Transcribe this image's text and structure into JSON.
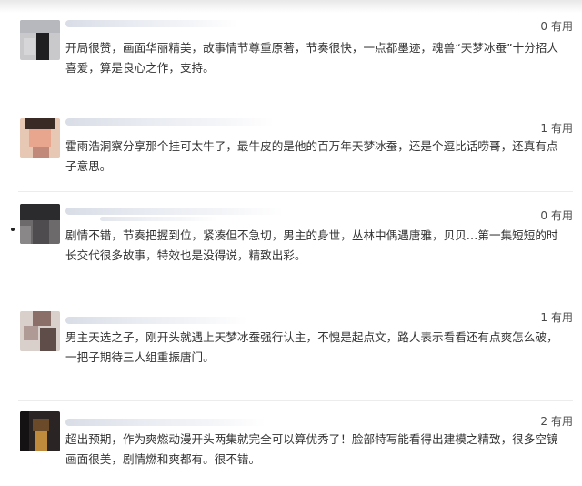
{
  "reviews": [
    {
      "count": "0",
      "useful_label": "有用",
      "text": "开局很赞，画面华丽精美，故事情节尊重原著，节奏很快，一点都墨迹，魂兽“天梦冰蚕”十分招人喜爱，算是良心之作，支持。"
    },
    {
      "count": "1",
      "useful_label": "有用",
      "text": "霍雨浩洞察分享那个挂可太牛了，最牛皮的是他的百万年天梦冰蚕，还是个逗比话唠哥，还真有点子意思。"
    },
    {
      "count": "0",
      "useful_label": "有用",
      "text": "剧情不错，节奏把握到位，紧凑但不急切，男主的身世，丛林中偶遇唐雅，贝贝…第一集短短的时长交代很多故事，特效也是没得说，精致出彩。"
    },
    {
      "count": "1",
      "useful_label": "有用",
      "text": "男主天选之子，刚开头就遇上天梦冰蚕强行认主，不愧是起点文，路人表示看看还有点爽怎么破，一把子期待三人组重振唐门。"
    },
    {
      "count": "2",
      "useful_label": "有用",
      "text": "超出预期，作为爽燃动漫开头两集就完全可以算优秀了！脸部特写能看得出建模之精致，很多空镜画面很美，剧情燃和爽都有。很不错。"
    }
  ],
  "colors": {
    "text": "#333333",
    "meta": "#4a4a4a",
    "divider": "#ececec"
  }
}
